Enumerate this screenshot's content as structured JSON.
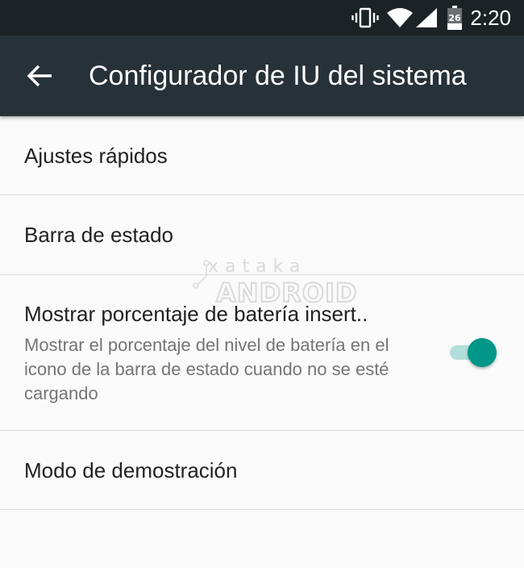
{
  "status_bar": {
    "time": "2:20",
    "battery_level": "26",
    "icons": [
      "vibrate-icon",
      "wifi-icon",
      "cell-signal-icon",
      "battery-icon"
    ]
  },
  "app_bar": {
    "title": "Configurador de IU del sistema",
    "back_icon": "arrow-left-icon",
    "background_color": "#263238"
  },
  "settings": {
    "items": [
      {
        "title": "Ajustes rápidos"
      },
      {
        "title": "Barra de estado"
      },
      {
        "title": "Mostrar porcentaje de batería insert..",
        "summary": "Mostrar el porcentaje del nivel de batería en el icono de la barra de estado cuando no se esté cargando",
        "toggle_on": true
      },
      {
        "title": "Modo de demostración"
      }
    ]
  },
  "watermark": {
    "line1": "xataka",
    "line2": "ANDROID"
  },
  "colors": {
    "accent": "#009688",
    "accent_track": "#b2dfdb",
    "status_bar": "#1c2326",
    "background": "#fafafa"
  }
}
